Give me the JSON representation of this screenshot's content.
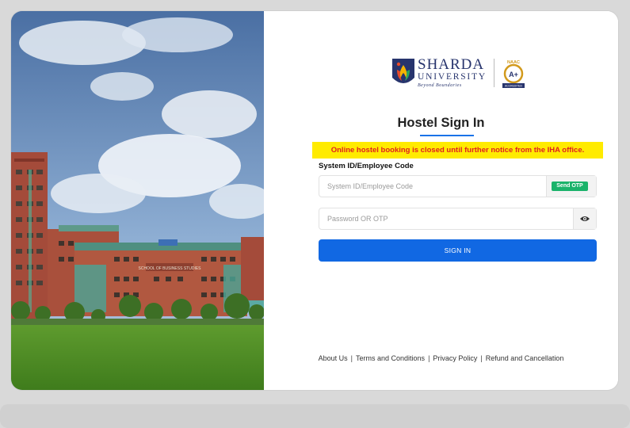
{
  "logo": {
    "brand_line1": "SHARDA",
    "brand_line2": "UNIVERSITY",
    "tagline": "Beyond Boundaries",
    "accreditation_top": "NAAC",
    "accreditation_grade": "A+",
    "accreditation_bottom": "ACCREDITED"
  },
  "page": {
    "title": "Hostel Sign In",
    "notice": "Online hostel booking is closed until further notice from the IHA office."
  },
  "form": {
    "id_label": "System ID/Employee Code",
    "id_placeholder": "System ID/Employee Code",
    "send_otp_label": "Send OTP",
    "password_placeholder": "Password OR OTP",
    "signin_label": "SIGN IN"
  },
  "footer": {
    "links": [
      "About Us",
      "Terms and Conditions",
      "Privacy Policy",
      "Refund and Cancellation"
    ],
    "separator": "|"
  },
  "photo": {
    "building_sign": "SCHOOL OF BUSINESS STUDIES"
  },
  "colors": {
    "primary": "#1168e3",
    "notice_bg": "#ffeb00",
    "notice_text": "#e02020",
    "otp_green": "#1bb36b",
    "brand_navy": "#27346d"
  },
  "icons": [
    "eye-icon",
    "university-crest-icon",
    "naac-badge-icon"
  ]
}
